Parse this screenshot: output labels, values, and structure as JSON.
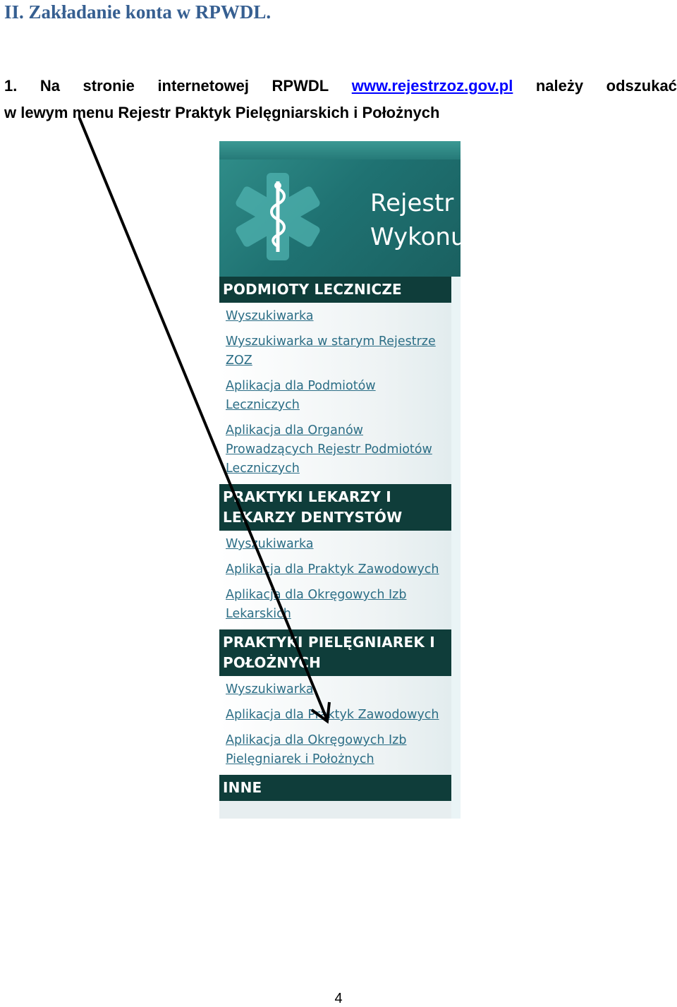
{
  "heading": "II. Zakładanie konta w RPWDL.",
  "instruction": {
    "number": "1.",
    "line1_words": [
      "Na",
      "stronie",
      "internetowej",
      "RPWDL"
    ],
    "link": "www.rejestrzoz.gov.pl",
    "line1_tail": [
      "należy",
      "odszukać"
    ],
    "line2": "w lewym menu Rejestr Praktyk Pielęgniarskich i Położnych"
  },
  "screenshot": {
    "title_line1": "Rejestr I",
    "title_line2": "Wykonu",
    "sections": [
      {
        "title": "PODMIOTY LECZNICZE",
        "items": [
          "Wyszukiwarka",
          "Wyszukiwarka w starym Rejestrze ZOZ",
          "Aplikacja dla Podmiotów Leczniczych",
          "Aplikacja dla Organów Prowadzących Rejestr Podmiotów Leczniczych"
        ]
      },
      {
        "title": "PRAKTYKI LEKARZY I LEKARZY DENTYSTÓW",
        "items": [
          "Wyszukiwarka",
          "Aplikacja dla Praktyk Zawodowych",
          "Aplikacja dla Okręgowych Izb Lekarskich"
        ]
      },
      {
        "title": "PRAKTYKI PIELĘGNIAREK I POŁOŻNYCH",
        "items": [
          "Wyszukiwarka",
          "Aplikacja dla Praktyk Zawodowych",
          "Aplikacja dla Okręgowych Izb Pielęgniarek i Położnych"
        ]
      },
      {
        "title": "INNE",
        "items": []
      }
    ]
  },
  "page_number": "4",
  "colors": {
    "heading": "#365f91",
    "link": "#0000ff",
    "menu_header": "#0f3d3a",
    "menu_link": "#2c6e86"
  }
}
